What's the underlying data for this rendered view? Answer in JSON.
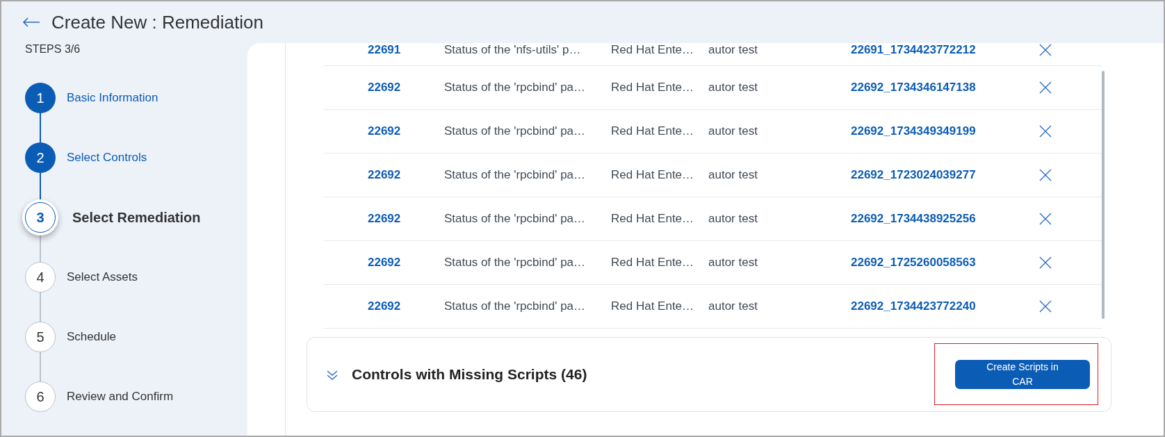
{
  "header": {
    "title": "Create New : Remediation"
  },
  "steps": {
    "counter": "STEPS 3/6",
    "items": [
      {
        "number": "1",
        "label": "Basic Information",
        "completed": true,
        "selected": false
      },
      {
        "number": "2",
        "label": "Select Controls",
        "completed": true,
        "selected": false
      },
      {
        "number": "3",
        "label": "Select Remediation",
        "completed": false,
        "selected": true
      },
      {
        "number": "4",
        "label": "Select Assets",
        "completed": false,
        "selected": false
      },
      {
        "number": "5",
        "label": "Schedule",
        "completed": false,
        "selected": false
      },
      {
        "number": "6",
        "label": "Review and Confirm",
        "completed": false,
        "selected": false
      }
    ]
  },
  "table": {
    "rows": [
      {
        "control_id": "22691",
        "description": "Status of the 'nfs-utils' p…",
        "platform": "Red Hat Ente…",
        "author": "autor test",
        "script_id": "22691_1734423772212"
      },
      {
        "control_id": "22692",
        "description": "Status of the 'rpcbind' pa…",
        "platform": "Red Hat Ente…",
        "author": "autor test",
        "script_id": "22692_1734346147138"
      },
      {
        "control_id": "22692",
        "description": "Status of the 'rpcbind' pa…",
        "platform": "Red Hat Ente…",
        "author": "autor test",
        "script_id": "22692_1734349349199"
      },
      {
        "control_id": "22692",
        "description": "Status of the 'rpcbind' pa…",
        "platform": "Red Hat Ente…",
        "author": "autor test",
        "script_id": "22692_1723024039277"
      },
      {
        "control_id": "22692",
        "description": "Status of the 'rpcbind' pa…",
        "platform": "Red Hat Ente…",
        "author": "autor test",
        "script_id": "22692_1734438925256"
      },
      {
        "control_id": "22692",
        "description": "Status of the 'rpcbind' pa…",
        "platform": "Red Hat Ente…",
        "author": "autor test",
        "script_id": "22692_1725260058563"
      },
      {
        "control_id": "22692",
        "description": "Status of the 'rpcbind' pa…",
        "platform": "Red Hat Ente…",
        "author": "autor test",
        "script_id": "22692_1734423772240"
      }
    ]
  },
  "missing_scripts": {
    "title": "Controls with Missing Scripts (46)",
    "expanded": false,
    "button": "Create Scripts in CAR"
  }
}
